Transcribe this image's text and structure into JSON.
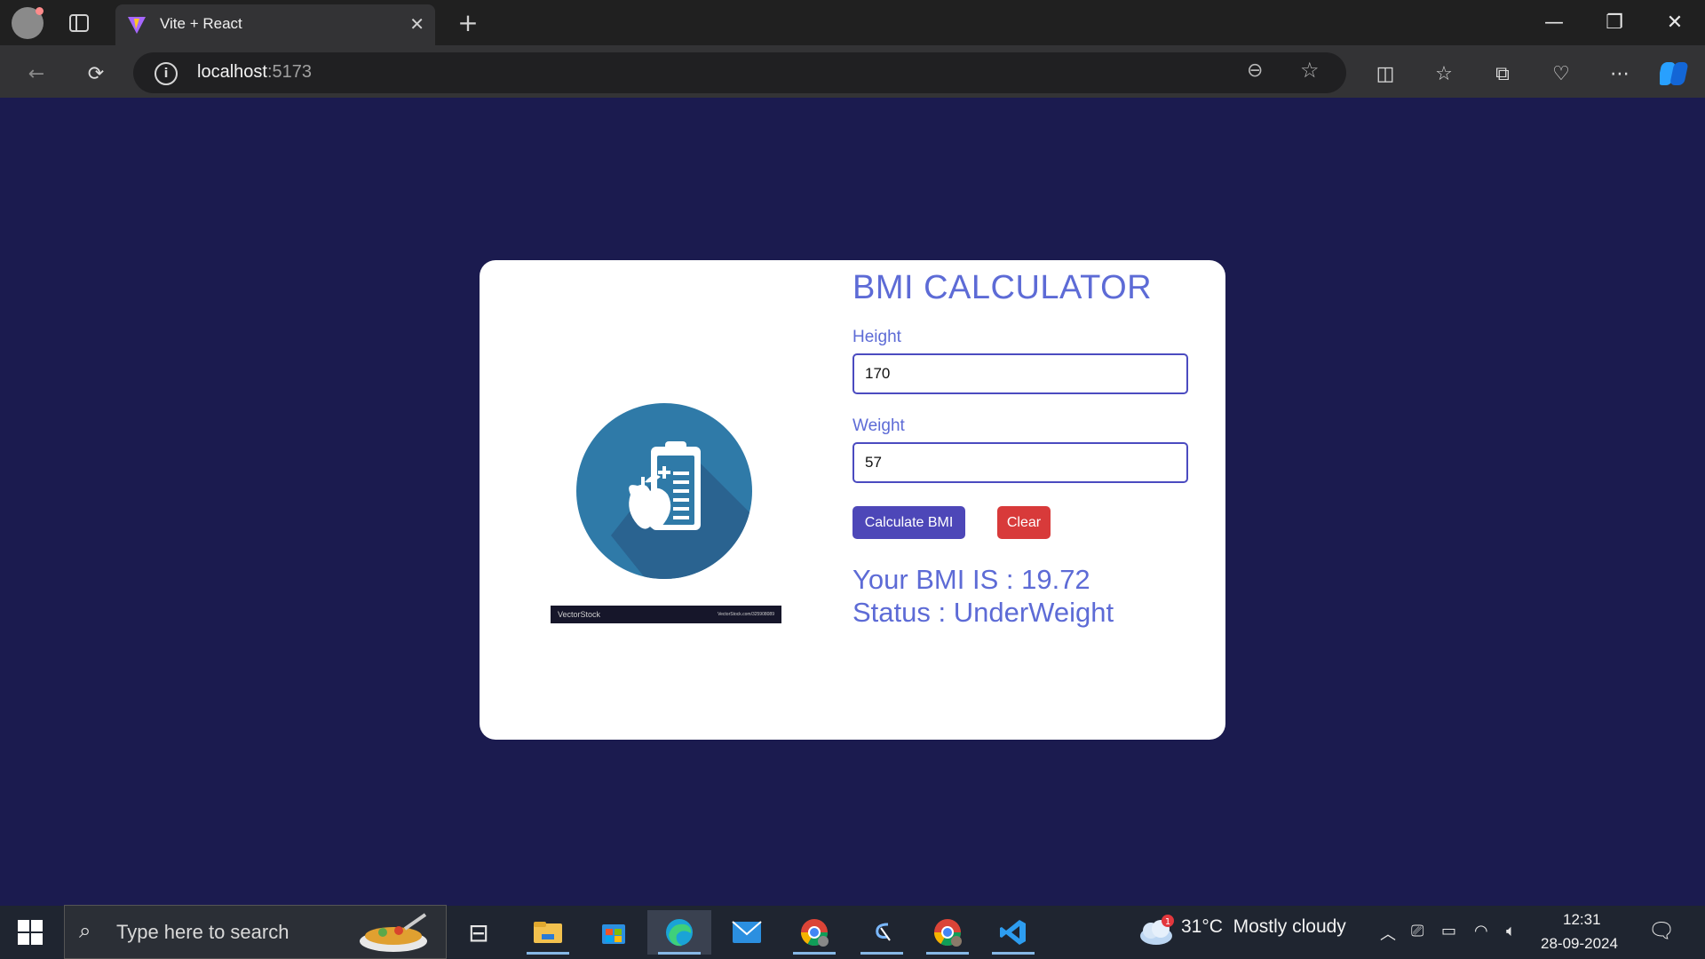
{
  "browser": {
    "tab_title": "Vite + React",
    "url_host": "localhost",
    "url_port": ":5173"
  },
  "app": {
    "title": "BMI CALCULATOR",
    "height_label": "Height",
    "height_value": "170",
    "weight_label": "Weight",
    "weight_value": "57",
    "calc_button": "Calculate BMI",
    "clear_button": "Clear",
    "bmi_text": "Your BMI IS : 19.72",
    "status_text": "Status : UnderWeight",
    "watermark_brand": "VectorStock",
    "watermark_url": "VectorStock.com/325908089"
  },
  "taskbar": {
    "search_placeholder": "Type here to search",
    "weather_temp": "31°C",
    "weather_text": "Mostly cloudy",
    "weather_badge": "1",
    "time": "12:31",
    "date": "28-09-2024"
  },
  "colors": {
    "page_bg": "#1b1b4f",
    "accent": "#5d6bd6",
    "calc_button": "#4d47b8",
    "clear_button": "#d83a3a"
  }
}
